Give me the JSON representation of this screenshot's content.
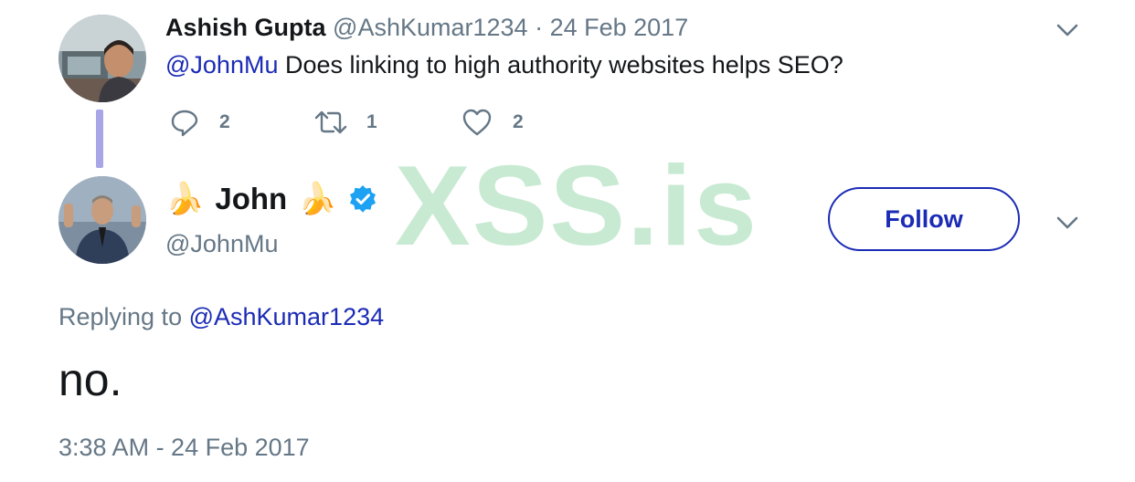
{
  "parent_tweet": {
    "author_name": "Ashish Gupta",
    "author_handle": "@AshKumar1234",
    "separator": "·",
    "date": "24 Feb 2017",
    "mention": "@JohnMu",
    "text": " Does linking to high authority websites helps SEO?",
    "reply_count": "2",
    "retweet_count": "1",
    "like_count": "2"
  },
  "reply_tweet": {
    "author_name": "John",
    "author_emoji": "🍌",
    "author_handle": "@JohnMu",
    "verified": true,
    "follow_label": "Follow",
    "replying_prefix": "Replying to ",
    "replying_to": "@AshKumar1234",
    "text": "no.",
    "timestamp": "3:38 AM - 24 Feb 2017"
  },
  "watermark": "XSS.is",
  "colors": {
    "link": "#1b2bb5",
    "muted": "#657786",
    "thread_line": "#a9a6e8",
    "verified": "#1da1f2",
    "watermark": "#b6e3c4"
  }
}
